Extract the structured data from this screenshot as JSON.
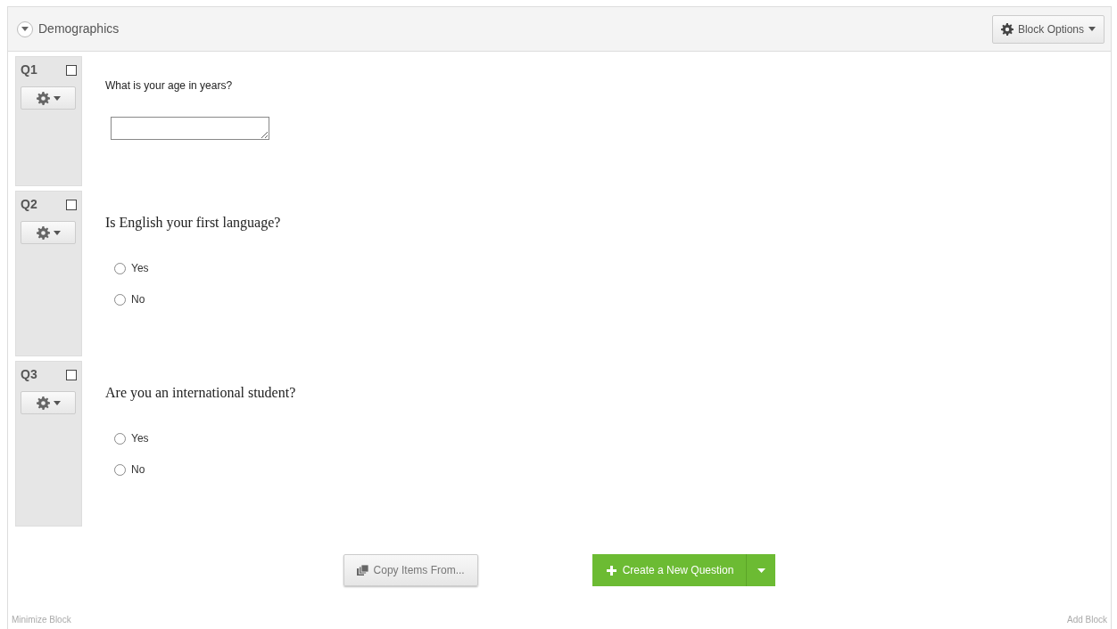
{
  "block": {
    "title": "Demographics",
    "expanded": true,
    "options_button": "Block Options"
  },
  "questions": [
    {
      "number": "Q1",
      "checked": false,
      "kind": "text_entry",
      "text": "What is your age in years?"
    },
    {
      "number": "Q2",
      "checked": false,
      "kind": "multiple_choice",
      "text": "Is English your first language?",
      "choices": [
        {
          "label": "Yes",
          "selected": false
        },
        {
          "label": "No",
          "selected": false
        }
      ]
    },
    {
      "number": "Q3",
      "checked": false,
      "kind": "multiple_choice",
      "text": "Are you an international student?",
      "choices": [
        {
          "label": "Yes",
          "selected": false
        },
        {
          "label": "No",
          "selected": false
        }
      ]
    }
  ],
  "buttons": {
    "copy": "Copy Items From...",
    "create": "Create a New Question"
  },
  "footer": {
    "left": "Minimize Block",
    "right": "Add Block"
  }
}
